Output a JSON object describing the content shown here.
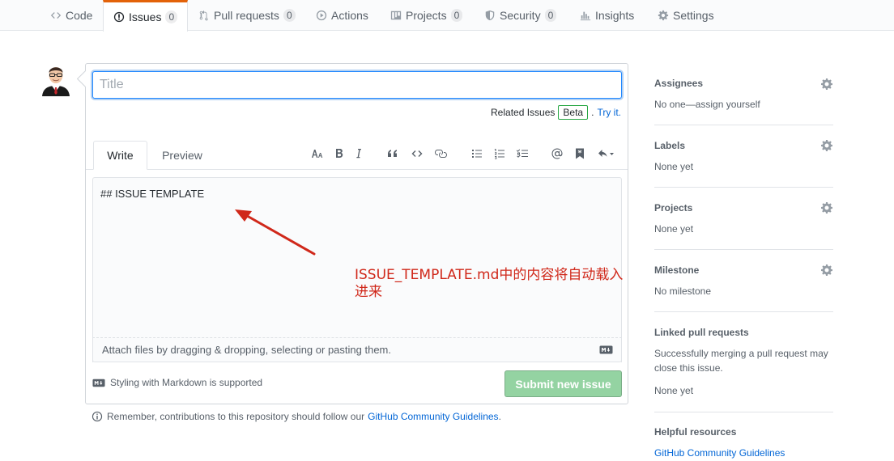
{
  "nav": {
    "tabs": [
      {
        "label": "Code",
        "icon": "code-icon"
      },
      {
        "label": "Issues",
        "icon": "issue-icon",
        "count": "0"
      },
      {
        "label": "Pull requests",
        "icon": "pull-request-icon",
        "count": "0"
      },
      {
        "label": "Actions",
        "icon": "play-icon"
      },
      {
        "label": "Projects",
        "icon": "project-icon",
        "count": "0"
      },
      {
        "label": "Security",
        "icon": "shield-icon",
        "count": "0"
      },
      {
        "label": "Insights",
        "icon": "graph-icon"
      },
      {
        "label": "Settings",
        "icon": "gear-icon"
      }
    ],
    "selected": "Issues"
  },
  "form": {
    "title_placeholder": "Title",
    "title_value": "",
    "related_text": "Related Issues",
    "beta_label": "Beta",
    "try_it": "Try it.",
    "tabs": {
      "write": "Write",
      "preview": "Preview"
    },
    "toolbar": [
      "header-icon",
      "bold-icon",
      "italic-icon",
      "quote-icon",
      "code-icon",
      "link-icon",
      "unordered-list-icon",
      "ordered-list-icon",
      "task-list-icon",
      "mention-icon",
      "saved-reply-icon",
      "reply-icon"
    ],
    "editor_text": "## ISSUE TEMPLATE",
    "attach_text": "Attach files by dragging & dropping, selecting or pasting them.",
    "markdown_support": "Styling with Markdown is supported",
    "submit_label": "Submit new issue",
    "remember_text": "Remember, contributions to this repository should follow our",
    "guidelines_link": "GitHub Community Guidelines",
    "remember_end": "."
  },
  "annotation": {
    "text": "ISSUE_TEMPLATE.md中的内容将自动载入进来",
    "color": "#d0281a"
  },
  "sidebar": {
    "assignees": {
      "heading": "Assignees",
      "value": "No one—assign yourself"
    },
    "labels": {
      "heading": "Labels",
      "value": "None yet"
    },
    "projects": {
      "heading": "Projects",
      "value": "None yet"
    },
    "milestone": {
      "heading": "Milestone",
      "value": "No milestone"
    },
    "linked": {
      "heading": "Linked pull requests",
      "description": "Successfully merging a pull request may close this issue.",
      "value": "None yet"
    },
    "helpful": {
      "heading": "Helpful resources",
      "link": "GitHub Community Guidelines"
    }
  },
  "colors": {
    "accent": "#0366d6",
    "tab_highlight": "#e36209",
    "submit_disabled": "#94d3a2",
    "annotation": "#d0281a"
  }
}
